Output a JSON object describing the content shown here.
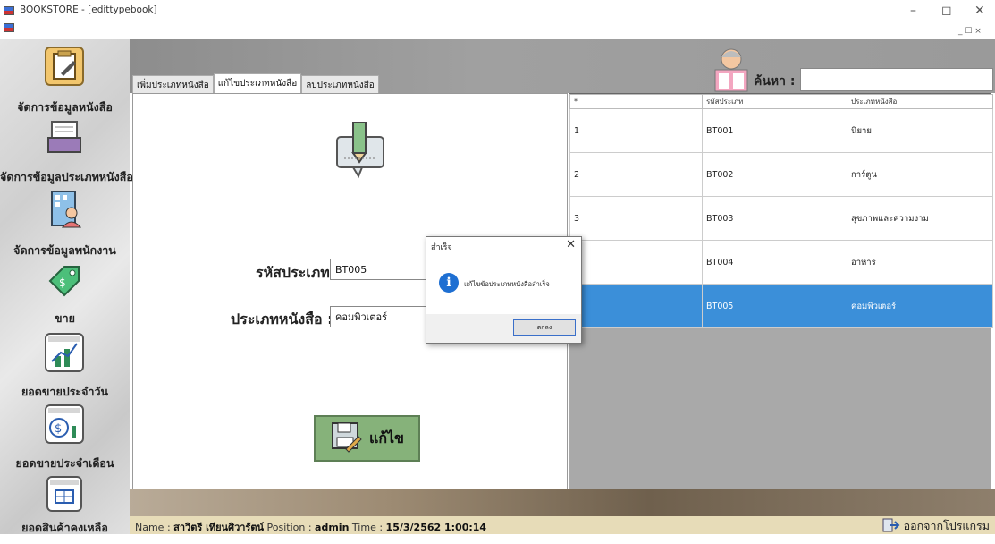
{
  "window": {
    "title": "BOOKSTORE - [edittypebook]",
    "controls": {
      "minimize": "–",
      "maximize": "◻",
      "close": "✕"
    },
    "mdi_controls": "_ ☐ ×"
  },
  "sidebar": {
    "items": [
      {
        "label": "จัดการข้อมูลหนังสือ",
        "icon": "book-edit-icon",
        "color": "#f2c66d"
      },
      {
        "label": "จัดการข้อมูลประเภทหนังสือ",
        "icon": "inbox-tray-icon",
        "color": "#ffffff"
      },
      {
        "label": "จัดการข้อมูลพนักงาน",
        "icon": "employee-building-icon",
        "color": "#8ec0e8"
      },
      {
        "label": "ขาย",
        "icon": "price-tag-icon",
        "color": "#4cbf7a"
      },
      {
        "label": "ยอดขายประจำวัน",
        "icon": "daily-chart-icon",
        "color": "#ffffff"
      },
      {
        "label": "ยอดขายประจำเดือน",
        "icon": "monthly-money-icon",
        "color": "#ffffff"
      },
      {
        "label": "ยอดสินค้าคงเหลือ",
        "icon": "inventory-icon",
        "color": "#ffffff"
      }
    ]
  },
  "tabs": [
    {
      "label": "เพิ่มประเภทหนังสือ",
      "active": false
    },
    {
      "label": "แก้ไขประเภทหนังสือ",
      "active": true
    },
    {
      "label": "ลบประเภทหนังสือ",
      "active": false
    }
  ],
  "form": {
    "code_label": "รหัสประเภท :",
    "code_value": "BT005",
    "type_label": "ประเภทหนังสือ :",
    "type_value": "คอมพิวเตอร์",
    "edit_button": "แก้ไข"
  },
  "search": {
    "label": "ค้นหา :",
    "value": ""
  },
  "grid": {
    "columns": [
      "*",
      "รหัสประเภท",
      "ประเภทหนังสือ"
    ],
    "rows": [
      {
        "no": "1",
        "code": "BT001",
        "type": "นิยาย",
        "selected": false
      },
      {
        "no": "2",
        "code": "BT002",
        "type": "การ์ตูน",
        "selected": false
      },
      {
        "no": "3",
        "code": "BT003",
        "type": "สุขภาพและความงาม",
        "selected": false
      },
      {
        "no": "",
        "code": "BT004",
        "type": "อาหาร",
        "selected": false
      },
      {
        "no": "",
        "code": "BT005",
        "type": "คอมพิวเตอร์",
        "selected": true
      }
    ],
    "selection_color": "#3b8fd9"
  },
  "dialog": {
    "title": "สำเร็จ",
    "message": "แก้ไขข้อประเภทหนังสือสำเร็จ",
    "ok_button": "ตกลง",
    "icon": "info-icon"
  },
  "status": {
    "name_label": "Name :",
    "name_value": "สาวิตรี เทียนศิวารัตน์",
    "position_label": "Position :",
    "position_value": "admin",
    "time_label": "Time :",
    "time_value": "15/3/2562 1:00:14",
    "exit_label": "ออกจากโปรแกรม"
  }
}
